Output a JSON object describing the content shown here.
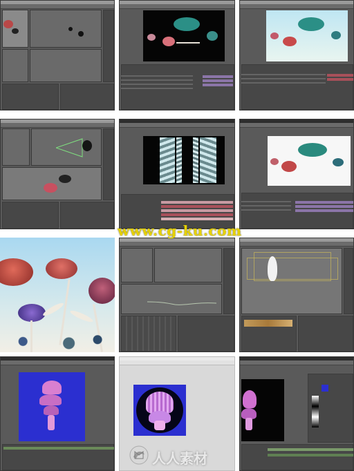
{
  "screenshot": {
    "description_type": "collage",
    "tile_count": 12,
    "columns": 3,
    "rows": 4
  },
  "watermark": {
    "text": "www.cg-ku.com"
  },
  "logo": {
    "text": "人人素材",
    "icon": "swirl-logo-icon"
  },
  "colors": {
    "app_dark": "#5a5a5a",
    "panel": "#474747",
    "timeline_pink": "#b28ea3",
    "timeline_red": "#a8505a",
    "watermark_yellow": "#e6d100",
    "mushroom_pink": "#d97fd0",
    "sky_blue": "#a9d8f0",
    "canvas_blue": "#2b2fd0"
  }
}
